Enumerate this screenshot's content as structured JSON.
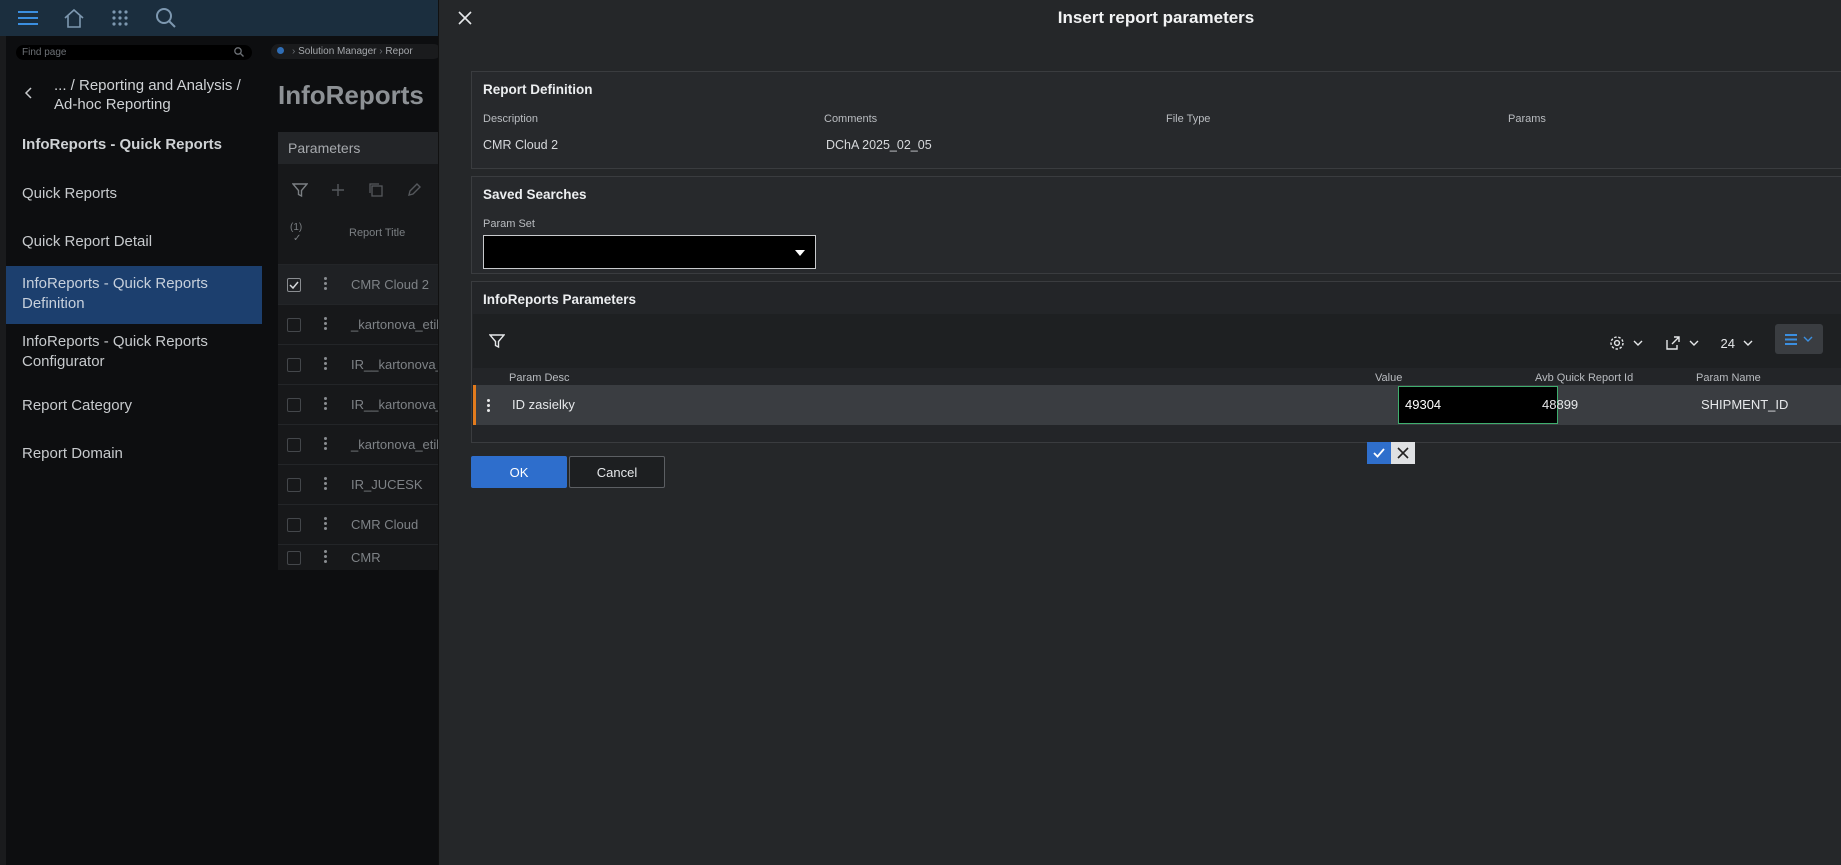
{
  "nav": {
    "find_placeholder": "Find page",
    "crumb": "... / Reporting and Analysis / Ad-hoc Reporting",
    "title": "InfoReports - Quick Reports",
    "items": [
      {
        "label": "Quick Reports"
      },
      {
        "label": "Quick Report Detail"
      },
      {
        "label": "InfoReports - Quick Reports Definition",
        "active": true
      },
      {
        "label": "InfoReports - Quick Reports Configurator"
      },
      {
        "label": "Report Category"
      },
      {
        "label": "Report Domain"
      }
    ]
  },
  "page": {
    "breadcrumb": [
      "Solution Manager",
      "Repor"
    ],
    "title": "InfoReports",
    "panel_title": "Parameters",
    "selected_count": "(1)",
    "col_report_title": "Report Title",
    "rows": [
      "CMR Cloud 2",
      "_kartonova_etik",
      "IR__kartonova_e",
      "IR__kartonova_e",
      "_kartonova_etik",
      "IR_JUCESK",
      "CMR Cloud",
      "CMR"
    ]
  },
  "modal": {
    "title": "Insert report parameters",
    "definition": {
      "title": "Report Definition",
      "description_label": "Description",
      "description_value": "CMR Cloud 2",
      "comments_label": "Comments",
      "comments_value": "DChA 2025_02_05",
      "file_type_label": "File Type",
      "params_label": "Params"
    },
    "saved": {
      "title": "Saved Searches",
      "param_set_label": "Param Set",
      "param_set_value": ""
    },
    "params": {
      "title": "InfoReports Parameters",
      "page_size": "24",
      "columns": {
        "desc": "Param Desc",
        "value": "Value",
        "report_id": "Avb Quick Report Id",
        "name": "Param Name"
      },
      "row": {
        "desc": "ID zasielky",
        "value": "49304",
        "report_id": "48899",
        "name": "SHIPMENT_ID"
      }
    },
    "ok_label": "OK",
    "cancel_label": "Cancel"
  },
  "colors": {
    "accent": "#2e6ecc",
    "row_marker": "#e27b1d",
    "nav_active": "#1c3f6e",
    "edit_border": "#3fae6e"
  }
}
